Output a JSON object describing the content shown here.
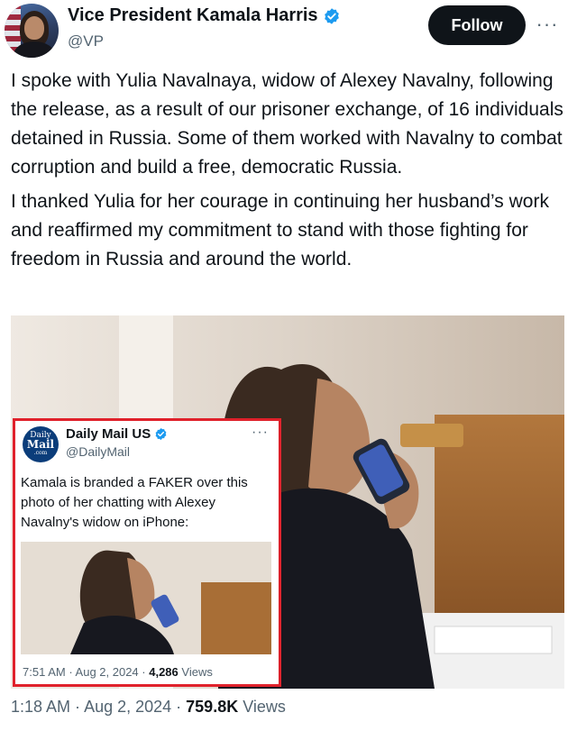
{
  "author": {
    "display_name": "Vice President Kamala Harris",
    "handle": "@VP",
    "verified": true
  },
  "actions": {
    "follow_label": "Follow",
    "more_label": "···"
  },
  "tweet": {
    "paragraphs": [
      "I spoke with Yulia Navalnaya, widow of Alexey Navalny, following the release, as a result of our prisoner exchange, of 16 individuals detained in Russia. Some of them worked with Navalny to combat corruption and build a free, democratic Russia.",
      "I thanked Yulia for her courage in continuing her husband’s work and reaffirmed my commitment to stand with those fighting for freedom in Russia and around the world."
    ],
    "time": "1:18 AM",
    "date": "Aug 2, 2024",
    "views_count": "759.8K",
    "views_label": "Views"
  },
  "embedded_tweet": {
    "avatar_lines": [
      "Daily",
      "Mail",
      ".com"
    ],
    "display_name": "Daily Mail US",
    "handle": "@DailyMail",
    "more_label": "···",
    "text": "Kamala is branded a FAKER over this photo of her chatting with Alexey Navalny's widow on iPhone:",
    "time": "7:51 AM",
    "date": "Aug 2, 2024",
    "views_count": "4,286",
    "views_label": "Views",
    "border_color": "#e0212b"
  },
  "colors": {
    "text": "#0f1419",
    "secondary": "#536471",
    "verified": "#1d9bf0",
    "follow_bg": "#0f1419"
  },
  "icons": {
    "verified": "verified-badge-icon",
    "more": "ellipsis-icon"
  }
}
